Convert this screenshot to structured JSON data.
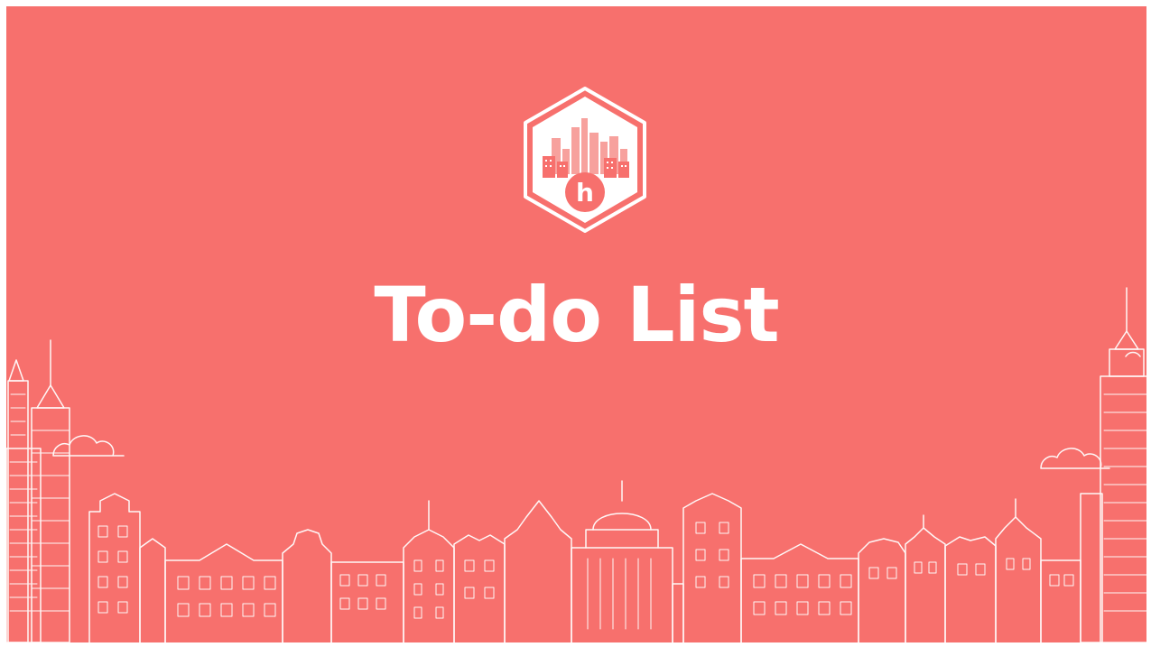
{
  "banner": {
    "title": "To-do List",
    "background_color": "#f7706d",
    "line_color": "#ffffff"
  },
  "logo": {
    "icon": "city-hexagon-logo-icon",
    "letter": "h"
  }
}
